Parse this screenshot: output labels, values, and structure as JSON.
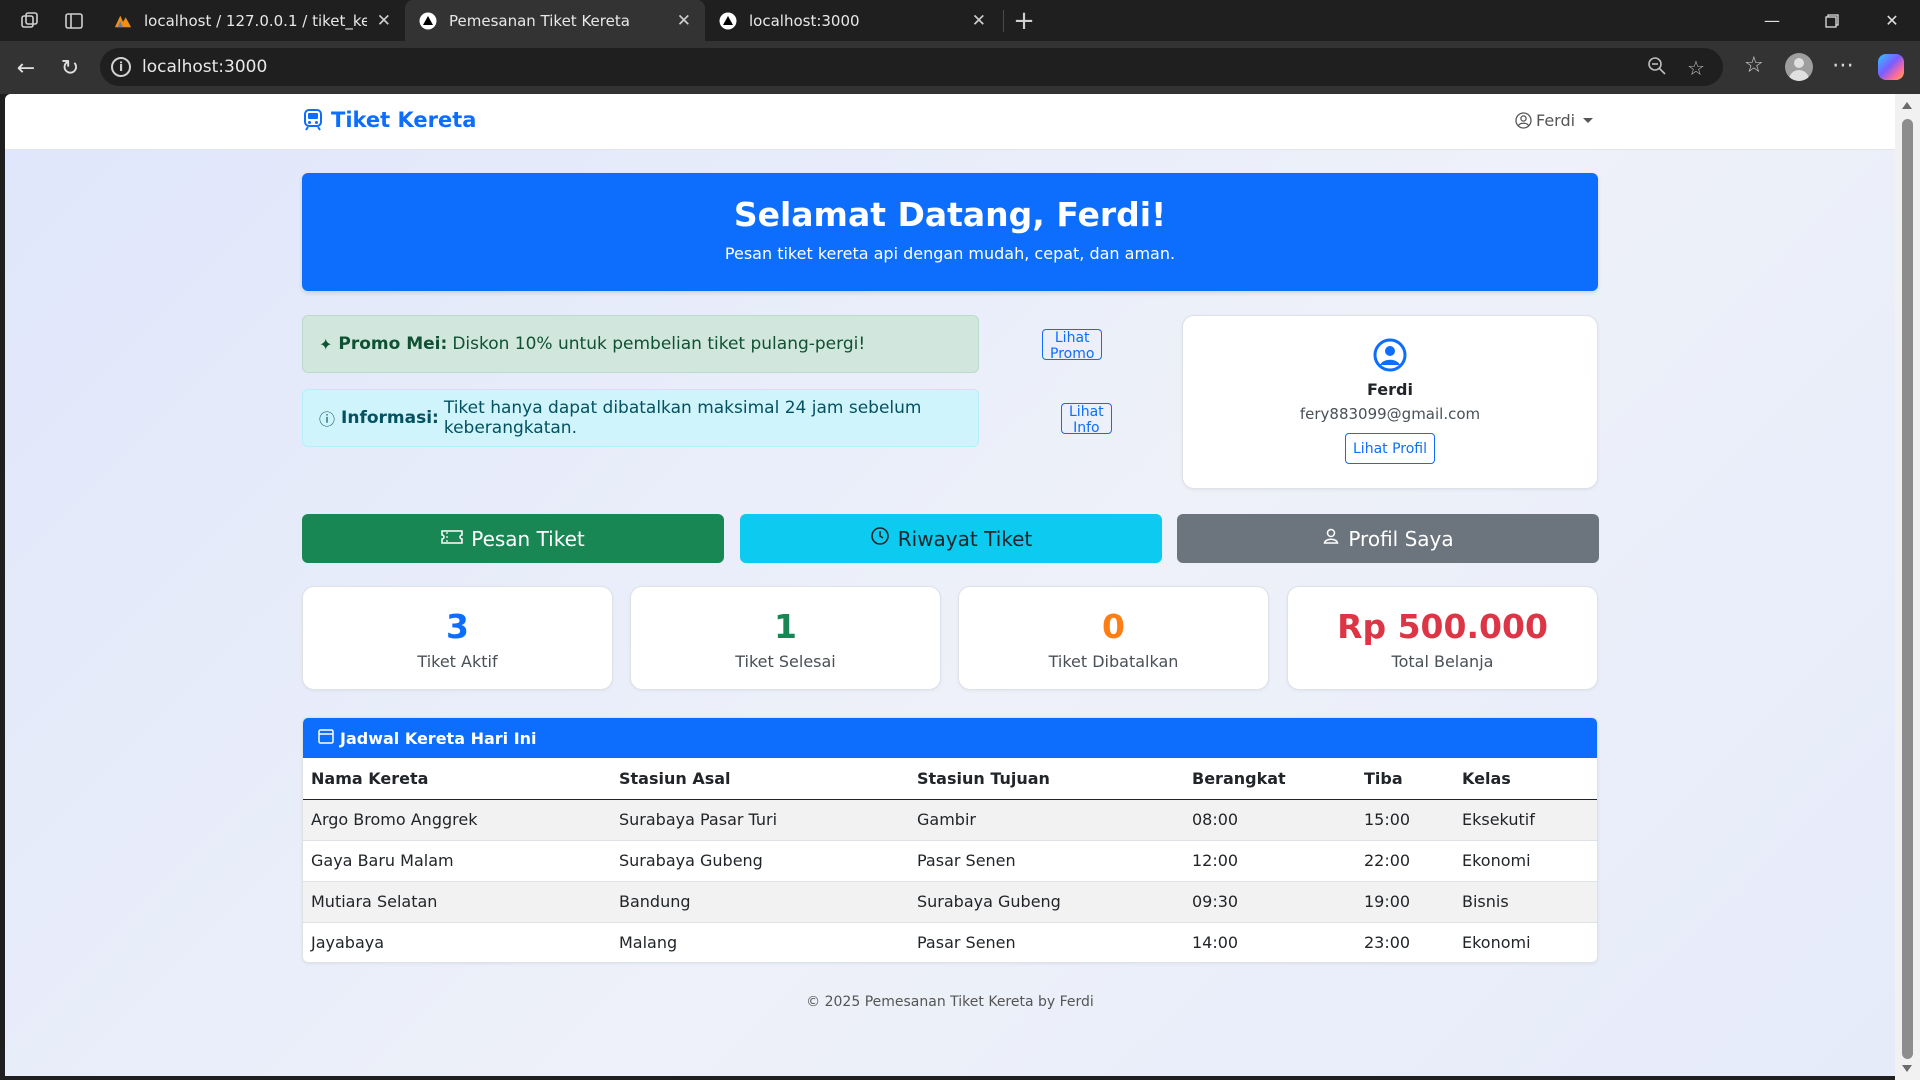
{
  "browser": {
    "tabs": [
      {
        "title": "localhost / 127.0.0.1 / tiket_kereta",
        "active": false
      },
      {
        "title": "Pemesanan Tiket Kereta",
        "active": true
      },
      {
        "title": "localhost:3000",
        "active": false
      }
    ],
    "url": "localhost:3000"
  },
  "navbar": {
    "brand": "Tiket Kereta",
    "user": "Ferdi"
  },
  "hero": {
    "title": "Selamat Datang, Ferdi!",
    "subtitle": "Pesan tiket kereta api dengan mudah, cepat, dan aman."
  },
  "alerts": {
    "promo": {
      "label": "Promo Mei:",
      "text": "Diskon 10% untuk pembelian tiket pulang-pergi!",
      "button": "Lihat Promo"
    },
    "info": {
      "label": "Informasi:",
      "text": "Tiket hanya dapat dibatalkan maksimal 24 jam sebelum keberangkatan.",
      "button": "Lihat Info"
    }
  },
  "profile": {
    "name": "Ferdi",
    "email": "fery883099@gmail.com",
    "button": "Lihat Profil"
  },
  "actions": {
    "pesan": "Pesan Tiket",
    "riwayat": "Riwayat Tiket",
    "profil": "Profil Saya"
  },
  "stats": [
    {
      "value": "3",
      "label": "Tiket Aktif",
      "color": "#0d6efd"
    },
    {
      "value": "1",
      "label": "Tiket Selesai",
      "color": "#198754"
    },
    {
      "value": "0",
      "label": "Tiket Dibatalkan",
      "color": "#fd7e14"
    },
    {
      "value": "Rp 500.000",
      "label": "Total Belanja",
      "color": "#dc3545"
    }
  ],
  "schedule": {
    "title": "Jadwal Kereta Hari Ini",
    "columns": [
      "Nama Kereta",
      "Stasiun Asal",
      "Stasiun Tujuan",
      "Berangkat",
      "Tiba",
      "Kelas"
    ],
    "rows": [
      [
        "Argo Bromo Anggrek",
        "Surabaya Pasar Turi",
        "Gambir",
        "08:00",
        "15:00",
        "Eksekutif"
      ],
      [
        "Gaya Baru Malam",
        "Surabaya Gubeng",
        "Pasar Senen",
        "12:00",
        "22:00",
        "Ekonomi"
      ],
      [
        "Mutiara Selatan",
        "Bandung",
        "Surabaya Gubeng",
        "09:30",
        "19:00",
        "Bisnis"
      ],
      [
        "Jayabaya",
        "Malang",
        "Pasar Senen",
        "14:00",
        "23:00",
        "Ekonomi"
      ]
    ]
  },
  "footer": "© 2025 Pemesanan Tiket Kereta by Ferdi"
}
